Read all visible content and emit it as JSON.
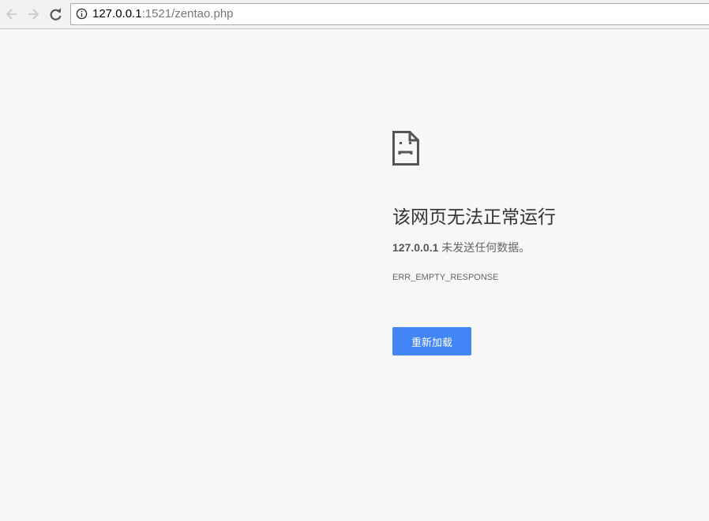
{
  "toolbar": {
    "url_host": "127.0.0.1",
    "url_rest": ":1521/zentao.php"
  },
  "error": {
    "title": "该网页无法正常运行",
    "host": "127.0.0.1",
    "message": " 未发送任何数据。",
    "code": "ERR_EMPTY_RESPONSE",
    "reload_label": "重新加载"
  },
  "colors": {
    "button": "#4285f4",
    "background": "#f7f7f7"
  }
}
